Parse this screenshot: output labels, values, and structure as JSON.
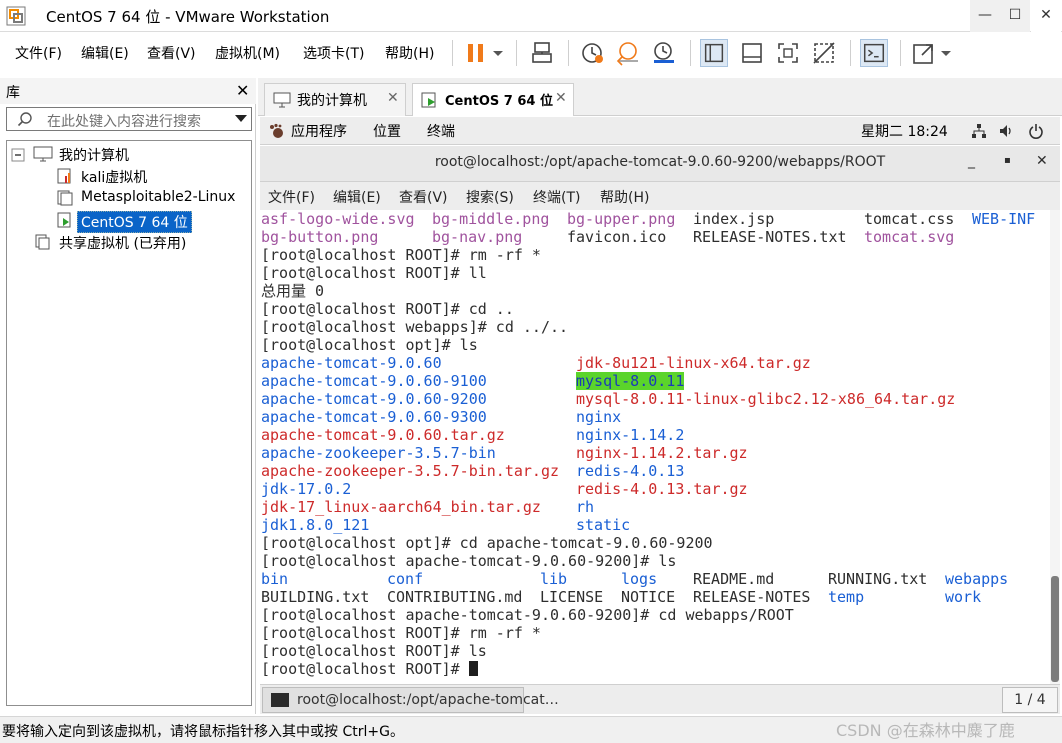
{
  "window": {
    "title": "CentOS 7 64 位 - VMware Workstation",
    "controls": {
      "minimize": "—",
      "maximize": "☐",
      "close": "✕"
    }
  },
  "menubar": {
    "items": [
      "文件(F)",
      "编辑(E)",
      "查看(V)",
      "虚拟机(M)",
      "选项卡(T)",
      "帮助(H)"
    ],
    "toolbar_icons": [
      "pause-icon",
      "dropdown-icon",
      "send-keys-icon",
      "snapshot-icon",
      "revert-snapshot-icon",
      "snapshot-manager-icon",
      "library-view-icon",
      "thumbnail-view-icon",
      "fullscreen-icon",
      "unity-icon",
      "console-icon",
      "stretch-icon",
      "dropdown-icon"
    ]
  },
  "library": {
    "title": "库",
    "close": "✕",
    "search_placeholder": "在此处键入内容进行搜索",
    "tree": {
      "root": "我的计算机",
      "vms": [
        "kali虚拟机",
        "Metasploitable2-Linux",
        "CentOS 7 64 位"
      ],
      "selected_index": 2,
      "shared": "共享虚拟机 (已弃用)"
    }
  },
  "tabs": [
    {
      "label": "我的计算机",
      "active": false,
      "close": "✕"
    },
    {
      "label": "CentOS 7 64 位",
      "active": true,
      "close": "✕"
    }
  ],
  "gnome": {
    "menus": [
      "应用程序",
      "位置",
      "终端"
    ],
    "clock": "星期二 18:24"
  },
  "terminal": {
    "title": "root@localhost:/opt/apache-tomcat-9.0.60-9200/webapps/ROOT",
    "controls": [
      "_",
      "▪",
      "✕"
    ],
    "menu": [
      "文件(F)",
      "编辑(E)",
      "查看(V)",
      "搜索(S)",
      "终端(T)",
      "帮助(H)"
    ],
    "lines": [
      [
        [
          "asf-logo-wide.svg",
          "pink",
          0
        ],
        [
          "bg-middle.png",
          "pink",
          171
        ],
        [
          "bg-upper.png",
          "pink",
          306
        ],
        [
          "index.jsp",
          "",
          432
        ],
        [
          "tomcat.css",
          "",
          603
        ],
        [
          "WEB-INF",
          "blue",
          711
        ]
      ],
      [
        [
          "bg-button.png",
          "pink",
          0
        ],
        [
          "bg-nav.png",
          "pink",
          171
        ],
        [
          "favicon.ico",
          "",
          306
        ],
        [
          "RELEASE-NOTES.txt",
          "",
          432
        ],
        [
          "tomcat.svg",
          "pink",
          603
        ]
      ],
      [
        [
          "[root@localhost ROOT]# rm -rf *",
          "",
          0
        ]
      ],
      [
        [
          "[root@localhost ROOT]# ll",
          "",
          0
        ]
      ],
      [
        [
          "总用量 0",
          "",
          0
        ]
      ],
      [
        [
          "[root@localhost ROOT]# cd ..",
          "",
          0
        ]
      ],
      [
        [
          "[root@localhost webapps]# cd ../..",
          "",
          0
        ]
      ],
      [
        [
          "[root@localhost opt]# ls",
          "",
          0
        ]
      ],
      [
        [
          "apache-tomcat-9.0.60",
          "blue",
          0
        ],
        [
          "jdk-8u121-linux-x64.tar.gz",
          "red",
          315
        ]
      ],
      [
        [
          "apache-tomcat-9.0.60-9100",
          "blue",
          0
        ],
        [
          "mysql-8.0.11",
          "hl",
          315
        ]
      ],
      [
        [
          "apache-tomcat-9.0.60-9200",
          "blue",
          0
        ],
        [
          "mysql-8.0.11-linux-glibc2.12-x86_64.tar.gz",
          "red",
          315
        ]
      ],
      [
        [
          "apache-tomcat-9.0.60-9300",
          "blue",
          0
        ],
        [
          "nginx",
          "blue",
          315
        ]
      ],
      [
        [
          "apache-tomcat-9.0.60.tar.gz",
          "red",
          0
        ],
        [
          "nginx-1.14.2",
          "blue",
          315
        ]
      ],
      [
        [
          "apache-zookeeper-3.5.7-bin",
          "blue",
          0
        ],
        [
          "nginx-1.14.2.tar.gz",
          "red",
          315
        ]
      ],
      [
        [
          "apache-zookeeper-3.5.7-bin.tar.gz",
          "red",
          0
        ],
        [
          "redis-4.0.13",
          "blue",
          315
        ]
      ],
      [
        [
          "jdk-17.0.2",
          "blue",
          0
        ],
        [
          "redis-4.0.13.tar.gz",
          "red",
          315
        ]
      ],
      [
        [
          "jdk-17_linux-aarch64_bin.tar.gz",
          "red",
          0
        ],
        [
          "rh",
          "blue",
          315
        ]
      ],
      [
        [
          "jdk1.8.0_121",
          "blue",
          0
        ],
        [
          "static",
          "blue",
          315
        ]
      ],
      [
        [
          "[root@localhost opt]# cd apache-tomcat-9.0.60-9200",
          "",
          0
        ]
      ],
      [
        [
          "[root@localhost apache-tomcat-9.0.60-9200]# ls",
          "",
          0
        ]
      ],
      [
        [
          "bin",
          "blue",
          0
        ],
        [
          "conf",
          "blue",
          126
        ],
        [
          "lib",
          "blue",
          279
        ],
        [
          "logs",
          "blue",
          360
        ],
        [
          "README.md",
          "",
          432
        ],
        [
          "RUNNING.txt",
          "",
          567
        ],
        [
          "webapps",
          "blue",
          684
        ]
      ],
      [
        [
          "BUILDING.txt",
          "",
          0
        ],
        [
          "CONTRIBUTING.md",
          "",
          126
        ],
        [
          "LICENSE",
          "",
          279
        ],
        [
          "NOTICE",
          "",
          360
        ],
        [
          "RELEASE-NOTES",
          "",
          432
        ],
        [
          "temp",
          "blue",
          567
        ],
        [
          "work",
          "blue",
          684
        ]
      ],
      [
        [
          "[root@localhost apache-tomcat-9.0.60-9200]# cd webapps/ROOT",
          "",
          0
        ]
      ],
      [
        [
          "[root@localhost ROOT]# rm -rf *",
          "",
          0
        ]
      ],
      [
        [
          "[root@localhost ROOT]# ls",
          "",
          0
        ]
      ],
      [
        [
          "[root@localhost ROOT]# ",
          "",
          0
        ]
      ]
    ]
  },
  "guest_taskbar": {
    "item": "root@localhost:/opt/apache-tomcat…",
    "pager": "1 / 4"
  },
  "statusbar": {
    "text": "要将输入定向到该虚拟机，请将鼠标指针移入其中或按 Ctrl+G。",
    "watermark": "CSDN @在森林中麋了鹿"
  },
  "colors": {
    "blue": "#1a5fd4",
    "red": "#cd2a2a",
    "pink": "#a0539e",
    "highlight": "#5bd42b",
    "selection": "#0a64c8"
  }
}
